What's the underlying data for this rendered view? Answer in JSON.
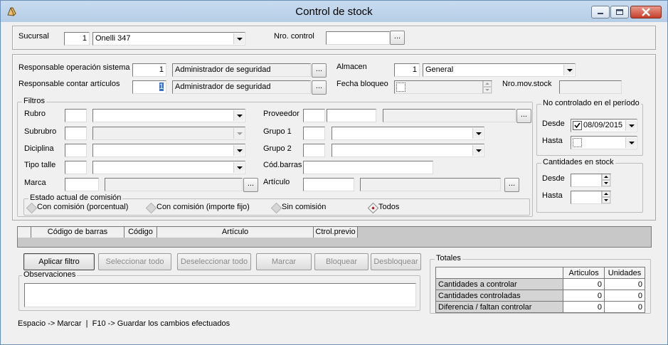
{
  "window": {
    "title": "Control de stock",
    "buttons": [
      "minimize-icon",
      "maximize-icon",
      "close-icon"
    ]
  },
  "header": {
    "sucursal_label": "Sucursal",
    "sucursal_code": "1",
    "sucursal_name": "Onelli 347",
    "nro_control_label": "Nro. control",
    "nro_control_value": ""
  },
  "responsables": {
    "operacion_label": "Responsable operación sistema",
    "operacion_code": "1",
    "operacion_name": "Administrador de seguridad",
    "contar_label": "Responsable contar artículos",
    "contar_code": "1",
    "contar_name": "Administrador de seguridad",
    "almacen_label": "Almacen",
    "almacen_code": "1",
    "almacen_name": "General",
    "fecha_bloqueo_label": "Fecha bloqueo",
    "nro_mov_label": "Nro.mov.stock",
    "nro_mov_value": ""
  },
  "filtros": {
    "title": "Filtros",
    "rubro": "Rubro",
    "subrubro": "Subrubro",
    "diciplina": "Diciplina",
    "tipo_talle": "Tipo talle",
    "marca": "Marca",
    "proveedor": "Proveedor",
    "grupo1": "Grupo 1",
    "grupo2": "Grupo 2",
    "cod_barras": "Cód.barras",
    "articulo": "Artículo"
  },
  "no_controlado": {
    "title": "No controlado en el período",
    "desde_label": "Desde",
    "desde_value": "08/09/2015",
    "hasta_label": "Hasta",
    "hasta_value": ""
  },
  "cantidades_stock": {
    "title": "Cantidades en stock",
    "desde_label": "Desde",
    "hasta_label": "Hasta"
  },
  "estado_comision": {
    "title": "Estado actual de comisión",
    "options": [
      {
        "label": "Con comisión (porcentual)",
        "selected": false
      },
      {
        "label": "Con comisión (importe fijo)",
        "selected": false
      },
      {
        "label": "Sin comisión",
        "selected": false
      },
      {
        "label": "Todos",
        "selected": true
      }
    ]
  },
  "grid": {
    "columns": [
      "",
      "Código de barras",
      "Código",
      "Artículo",
      "Ctrol.previo"
    ]
  },
  "actions": {
    "aplicar_filtro": "Aplicar filtro",
    "seleccionar_todo": "Seleccionar todo",
    "deseleccionar_todo": "Deseleccionar todo",
    "marcar": "Marcar",
    "bloquear": "Bloquear",
    "desbloquear": "Desbloquear"
  },
  "observaciones": {
    "label": "Observaciones",
    "value": ""
  },
  "totales": {
    "title": "Totales",
    "columns": [
      "Articulos",
      "Unidades"
    ],
    "rows": [
      {
        "label": "Cantidades a controlar",
        "articulos": "0",
        "unidades": "0"
      },
      {
        "label": "Cantidades controladas",
        "articulos": "0",
        "unidades": "0"
      },
      {
        "label": "Diferencia / faltan controlar",
        "articulos": "0",
        "unidades": "0"
      }
    ]
  },
  "status": {
    "hint": "Espacio -> Marcar  |  F10 -> Guardar los cambios efectuados"
  },
  "colors": {
    "titlebar": "#c8dcf0",
    "close_button": "#c7402a",
    "grid_background": "#c8c8c8",
    "selected_radio": "#c00000"
  }
}
